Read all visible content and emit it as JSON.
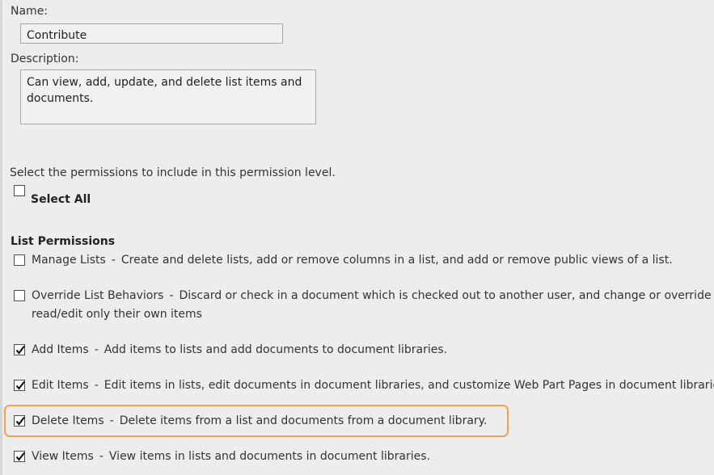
{
  "form": {
    "name_label": "Name:",
    "name_value": "Contribute",
    "description_label": "Description:",
    "description_value": "Can view, add, update, and delete list items and documents.",
    "instructions": "Select the permissions to include in this permission level.",
    "select_all_label": "Select All",
    "select_all_checked": false
  },
  "list_permissions": {
    "heading": "List Permissions",
    "items": [
      {
        "title": "Manage Lists",
        "separator": "-",
        "description": "Create and delete lists, add or remove columns in a list, and add or remove public views of a list.",
        "checked": false
      },
      {
        "title": "Override List Behaviors",
        "separator": "-",
        "description": "Discard or check in a document which is checked out to another user, and change or override setti",
        "description_line2": "read/edit only their own items",
        "checked": false
      },
      {
        "title": "Add Items",
        "separator": "-",
        "description": "Add items to lists and add documents to document libraries.",
        "checked": true
      },
      {
        "title": "Edit Items",
        "separator": "-",
        "description": "Edit items in lists, edit documents in document libraries, and customize Web Part Pages in document libraries.",
        "checked": true
      },
      {
        "title": "Delete Items",
        "separator": "-",
        "description": "Delete items from a list and documents from a document library.",
        "checked": true
      },
      {
        "title": "View Items",
        "separator": "-",
        "description": "View items in lists and documents in document libraries.",
        "checked": true
      }
    ]
  },
  "colors": {
    "highlight_outline": "#f2a256",
    "background": "#ededed"
  }
}
